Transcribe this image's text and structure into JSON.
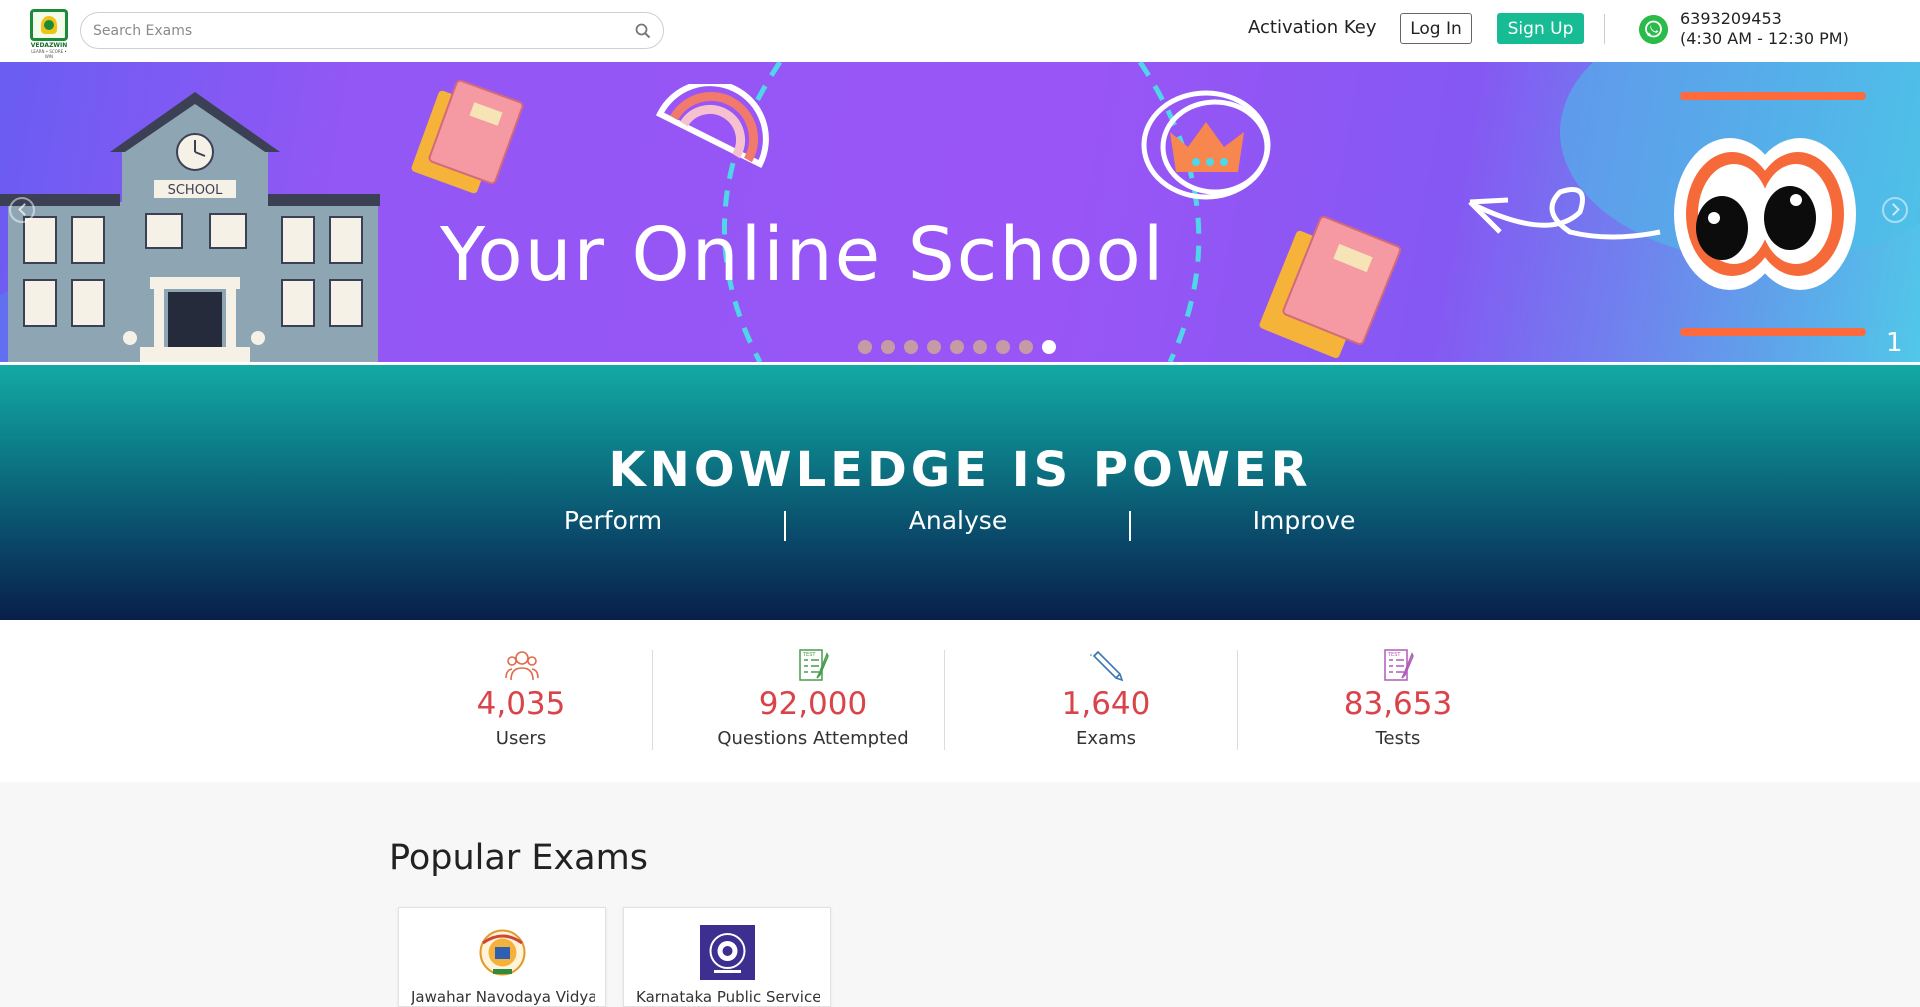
{
  "header": {
    "logo_text": "VEDAZWIN",
    "logo_sub": "LEARN • SCORE • WIN",
    "search_placeholder": "Search Exams",
    "activation_key_label": "Activation Key",
    "login_label": "Log In",
    "signup_label": "Sign Up",
    "phone": "6393209453",
    "hours": "(4:30 AM - 12:30 PM)"
  },
  "banner": {
    "headline": "Your Online School",
    "school_sign": "SCHOOL",
    "slide_count": 9,
    "active_slide": 9,
    "slide_number": "1"
  },
  "hero": {
    "title": "KNOWLEDGE IS POWER",
    "subtitles": [
      "Perform",
      "Analyse",
      "Improve"
    ]
  },
  "stats": [
    {
      "value": "4,035",
      "label": "Users",
      "icon": "users-icon",
      "color": "#e06a4a"
    },
    {
      "value": "92,000",
      "label": "Questions Attempted",
      "icon": "test-sheet-icon",
      "color": "#4a9c4e"
    },
    {
      "value": "1,640",
      "label": "Exams",
      "icon": "pen-icon",
      "color": "#3a78b8"
    },
    {
      "value": "83,653",
      "label": "Tests",
      "icon": "test-sheet-icon",
      "color": "#b05bb8"
    }
  ],
  "popular": {
    "title": "Popular Exams",
    "exams": [
      {
        "name": "Jawahar Navodaya Vidyalaya",
        "logo": "jnv-emblem-icon"
      },
      {
        "name": "Karnataka Public Service",
        "logo": "kpsc-emblem-icon"
      }
    ]
  },
  "colors": {
    "accent": "#17bc94",
    "stat_value": "#d9434a",
    "whatsapp": "#2bbb4a"
  }
}
